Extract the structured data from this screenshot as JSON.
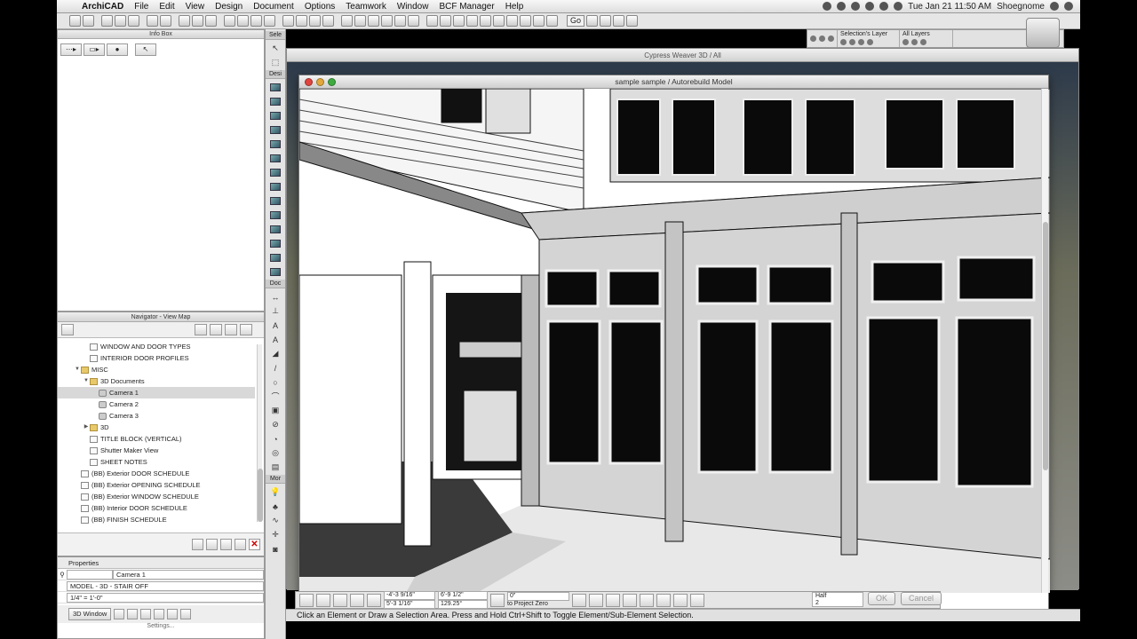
{
  "menubar": {
    "app": "ArchiCAD",
    "items": [
      "File",
      "Edit",
      "View",
      "Design",
      "Document",
      "Options",
      "Teamwork",
      "Window",
      "BCF Manager",
      "Help"
    ],
    "clock": "Tue Jan 21  11:50 AM",
    "user": "Shoegnome"
  },
  "toolbar": {
    "go_label": "Go"
  },
  "layers": {
    "selection_label": "Selection's Layer",
    "all_label": "All Layers"
  },
  "infobox": {
    "title": "Info Box"
  },
  "toolbox": {
    "headers": {
      "select": "Sele",
      "design": "Desi",
      "document": "Doc",
      "more": "Mor"
    }
  },
  "navigator": {
    "title": "Navigator - View Map",
    "tree": [
      {
        "label": "WINDOW AND DOOR TYPES",
        "indent": 2,
        "icon": "doc",
        "tri": ""
      },
      {
        "label": "INTERIOR DOOR PROFILES",
        "indent": 2,
        "icon": "doc",
        "tri": ""
      },
      {
        "label": "MISC",
        "indent": 1,
        "icon": "folder",
        "tri": "▼"
      },
      {
        "label": "3D Documents",
        "indent": 2,
        "icon": "folder",
        "tri": "▼"
      },
      {
        "label": "Camera 1",
        "indent": 3,
        "icon": "cam",
        "tri": "",
        "selected": true
      },
      {
        "label": "Camera 2",
        "indent": 3,
        "icon": "cam",
        "tri": ""
      },
      {
        "label": "Camera 3",
        "indent": 3,
        "icon": "cam",
        "tri": ""
      },
      {
        "label": "3D",
        "indent": 2,
        "icon": "folder",
        "tri": "▶"
      },
      {
        "label": "TITLE BLOCK (VERTICAL)",
        "indent": 2,
        "icon": "doc",
        "tri": ""
      },
      {
        "label": "Shutter Maker View",
        "indent": 2,
        "icon": "doc",
        "tri": ""
      },
      {
        "label": "SHEET NOTES",
        "indent": 2,
        "icon": "doc",
        "tri": ""
      },
      {
        "label": "(BB) Exterior DOOR SCHEDULE",
        "indent": 1,
        "icon": "doc",
        "tri": ""
      },
      {
        "label": "(BB) Exterior OPENING SCHEDULE",
        "indent": 1,
        "icon": "doc",
        "tri": ""
      },
      {
        "label": "(BB) Exterior WINDOW SCHEDULE",
        "indent": 1,
        "icon": "doc",
        "tri": ""
      },
      {
        "label": "(BB) Interior DOOR SCHEDULE",
        "indent": 1,
        "icon": "doc",
        "tri": ""
      },
      {
        "label": "(BB) FINISH SCHEDULE",
        "indent": 1,
        "icon": "doc",
        "tri": ""
      }
    ]
  },
  "properties": {
    "header": "Properties",
    "name_value": "Camera 1",
    "layer_value": "MODEL - 3D - STAIR OFF",
    "scale_value": "1/4\"    =    1'-0\"",
    "window_button": "3D Window",
    "settings_label": "Settings..."
  },
  "windows": {
    "background_title": "Cypress Weaver 3D / All",
    "main_title": "sample sample / Autorebuild Model"
  },
  "editbar": {
    "dx": "-4'-3 9/16\"",
    "dy": "5'-3 1/16\"",
    "dr": "6'-9 1/2\"",
    "angle": "129.25°",
    "dz": "0\"",
    "dz_label": "to Project Zero",
    "half_label": "Half",
    "half_value": "2",
    "ok": "OK",
    "cancel": "Cancel"
  },
  "status": {
    "text": "Click an Element or Draw a Selection Area. Press and Hold Ctrl+Shift to Toggle Element/Sub-Element Selection."
  },
  "colors": {
    "accent": "#3d6fb5",
    "window_dark": "#0a0a0a",
    "close_red": "#e0443e",
    "min_yellow": "#e2a83c",
    "zoom_green": "#3fab3f"
  }
}
